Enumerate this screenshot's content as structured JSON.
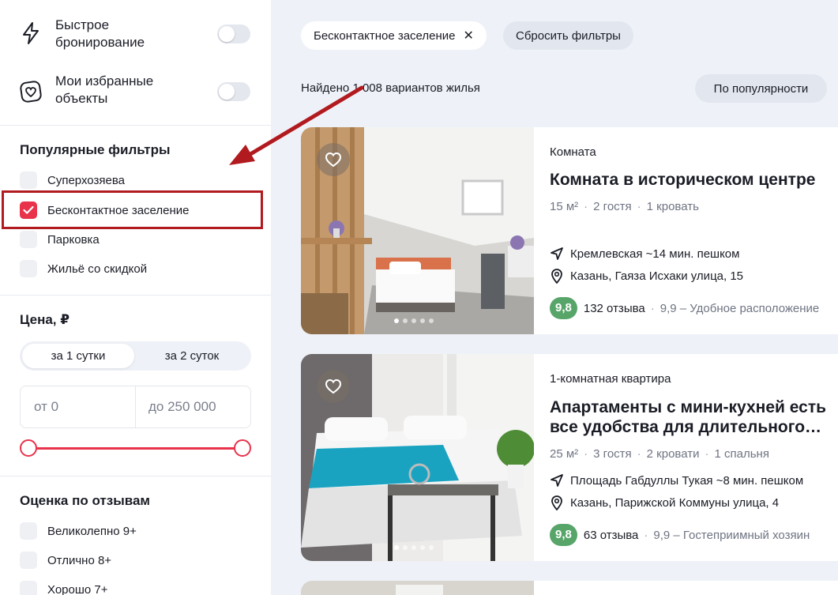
{
  "sidebar": {
    "toggles": [
      {
        "label": "Быстрое бронирование",
        "icon": "lightning-icon",
        "on": false
      },
      {
        "label": "Мои избранные объекты",
        "icon": "heart-icon",
        "on": false
      }
    ],
    "popular_title": "Популярные фильтры",
    "popular": [
      {
        "label": "Суперхозяева",
        "checked": false
      },
      {
        "label": "Бесконтактное заселение",
        "checked": true
      },
      {
        "label": "Парковка",
        "checked": false
      },
      {
        "label": "Жильё со скидкой",
        "checked": false
      }
    ],
    "price_title": "Цена, ₽",
    "price_periods": [
      "за 1 сутки",
      "за 2 суток"
    ],
    "price_period_selected": "за 1 сутки",
    "price_from_placeholder": "от 0",
    "price_to_placeholder": "до 250 000",
    "rating_title": "Оценка по отзывам",
    "rating": [
      {
        "label": "Великолепно 9+",
        "checked": false
      },
      {
        "label": "Отлично 8+",
        "checked": false
      },
      {
        "label": "Хорошо 7+",
        "checked": false
      }
    ]
  },
  "filters": {
    "active_chip": "Бесконтактное заселение",
    "chip_close": "✕",
    "reset_label": "Сбросить фильтры"
  },
  "results": {
    "found_text": "Найдено 1 008 вариантов жилья",
    "sort_label": "По популярности"
  },
  "listings": [
    {
      "type": "Комната",
      "title": "Комната в историческом центре",
      "meta": [
        "15 м²",
        "2 гостя",
        "1 кровать"
      ],
      "metro": "Кремлевская ~14 мин. пешком",
      "address": "Казань, Гаяза Исхаки улица, 15",
      "score": "9,8",
      "reviews": "132 отзыва",
      "note": "9,9 – Удобное расположение"
    },
    {
      "type": "1-комнатная квартира",
      "title": "Апартаменты с мини-кухней есть все удобства для длительного…",
      "meta": [
        "25 м²",
        "3 гостя",
        "2 кровати",
        "1 спальня"
      ],
      "metro": "Площадь Габдуллы Тукая ~8 мин. пешком",
      "address": "Казань, Парижской Коммуны улица, 4",
      "score": "9,8",
      "reviews": "63 отзыва",
      "note": "9,9 – Гостеприимный хозяин"
    }
  ],
  "colors": {
    "accent": "#e8334a",
    "annotation": "#b11a1f",
    "rating_green": "#58a56a",
    "background": "#eef1f7"
  }
}
